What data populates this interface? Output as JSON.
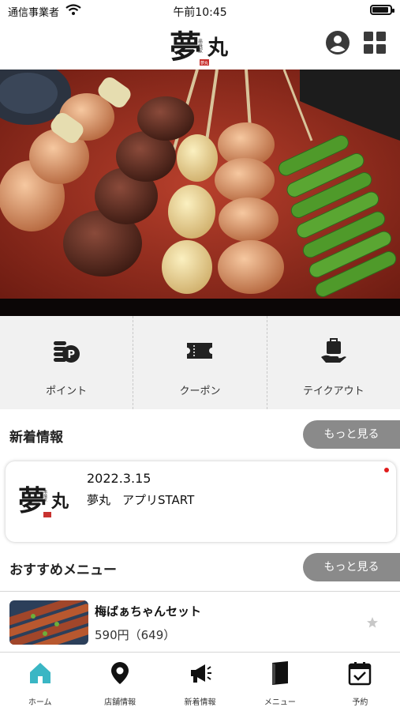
{
  "status_bar": {
    "carrier": "通信事業者",
    "time": "午前10:45"
  },
  "header": {
    "logo": "夢丸",
    "logo_sub": "串焼家",
    "logo_seal": "夢丸"
  },
  "quick_menu": [
    {
      "label": "ポイント",
      "icon": "points-coins-icon"
    },
    {
      "label": "クーポン",
      "icon": "coupon-ticket-icon"
    },
    {
      "label": "テイクアウト",
      "icon": "takeout-bag-icon"
    }
  ],
  "news_section": {
    "title": "新着情報",
    "more_label": "もっと見る"
  },
  "news": [
    {
      "date": "2022.3.15",
      "text": "夢丸　アプリSTART",
      "unread": true
    }
  ],
  "recommend_section": {
    "title": "おすすめメニュー",
    "more_label": "もっと見る"
  },
  "menu_items": [
    {
      "name": "梅ばぁちゃんセット",
      "price": "590円（649）"
    }
  ],
  "tab_bar": [
    {
      "label": "ホーム",
      "icon": "home-icon",
      "active": true
    },
    {
      "label": "店舗情報",
      "icon": "location-pin-icon",
      "active": false
    },
    {
      "label": "新着情報",
      "icon": "megaphone-icon",
      "active": false
    },
    {
      "label": "メニュー",
      "icon": "menu-book-icon",
      "active": false
    },
    {
      "label": "予約",
      "icon": "calendar-check-icon",
      "active": false
    }
  ],
  "colors": {
    "accent": "#3ab6c4",
    "more_button": "#8a8a8a",
    "quick_menu_bg": "#f1f1f1",
    "unread_dot": "#e01b1b"
  }
}
